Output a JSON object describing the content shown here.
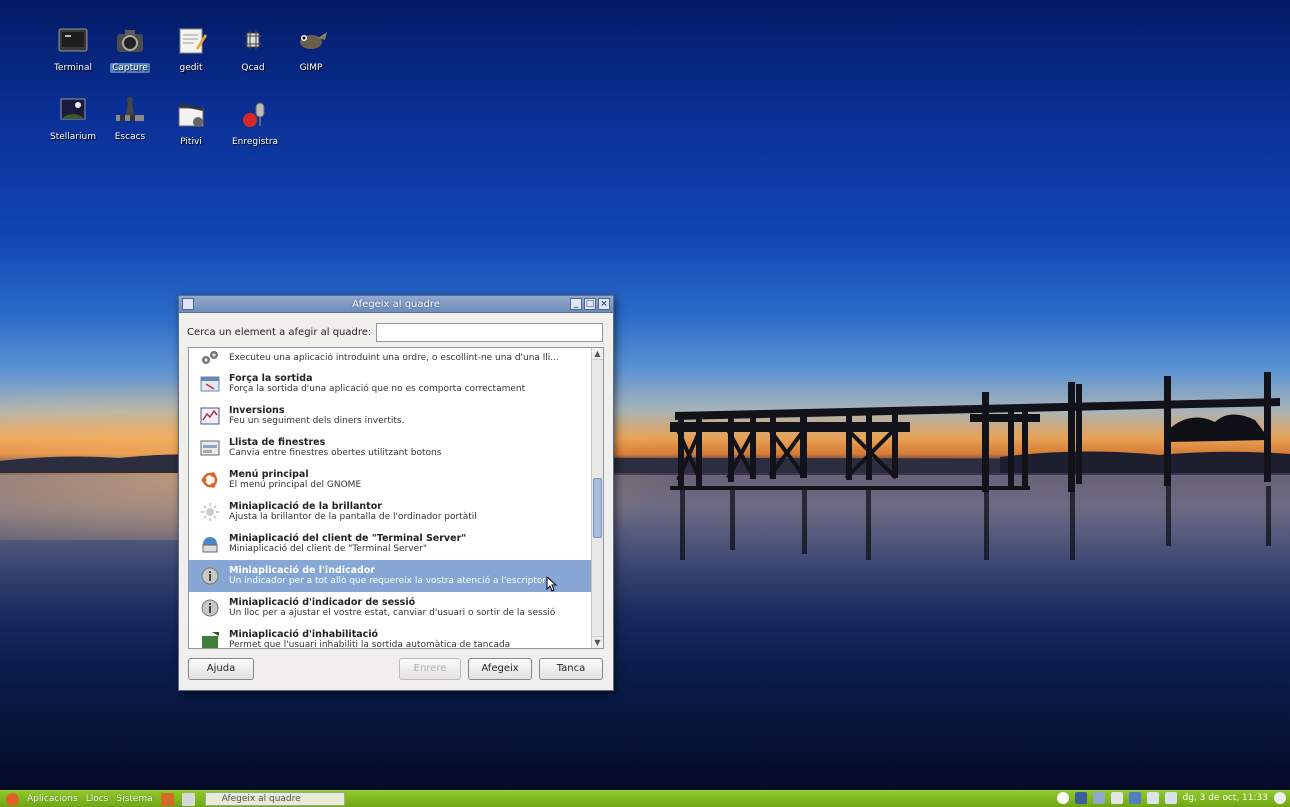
{
  "desktop": {
    "icons": [
      {
        "label": "Terminal",
        "icon": "terminal-icon"
      },
      {
        "label": "Capture",
        "icon": "camera-icon"
      },
      {
        "label": "gedit",
        "icon": "text-editor-icon"
      },
      {
        "label": "Qcad",
        "icon": "cad-icon"
      },
      {
        "label": "GIMP",
        "icon": "gimp-icon"
      },
      {
        "label": "Stellarium",
        "icon": "stellarium-icon"
      },
      {
        "label": "Escacs",
        "icon": "chess-icon"
      },
      {
        "label": "Pitivi",
        "icon": "video-editor-icon"
      },
      {
        "label": "Enregistra",
        "icon": "microphone-icon"
      }
    ]
  },
  "dialog": {
    "title": "Afegeix al quadre",
    "search_label": "Cerca un element a afegir al quadre:",
    "search_value": "",
    "items": [
      {
        "title": "",
        "desc": "Executeu una aplicació introduint una ordre, o escollint-ne una d'una lli...",
        "icon": "run-command-icon"
      },
      {
        "title": "Força la sortida",
        "desc": "Força la sortida d'una aplicació que no es comporta correctament",
        "icon": "force-quit-icon"
      },
      {
        "title": "Inversions",
        "desc": "Feu un seguiment dels diners invertits.",
        "icon": "investments-icon"
      },
      {
        "title": "Llista de finestres",
        "desc": "Canvia entre finestres obertes utilitzant botons",
        "icon": "window-list-icon"
      },
      {
        "title": "Menú principal",
        "desc": "El menú principal del GNOME",
        "icon": "ubuntu-logo-icon"
      },
      {
        "title": "Miniaplicació de la brillantor",
        "desc": "Ajusta la brillantor de la pantalla de l'ordinador portàtil",
        "icon": "brightness-icon"
      },
      {
        "title": "Miniaplicació del client de \"Terminal Server\"",
        "desc": "Miniaplicació del client de \"Terminal Server\"",
        "icon": "terminal-server-icon"
      },
      {
        "title": "Miniaplicació de l'indicador",
        "desc": "Un indicador per a tot allò que requereix la vostra atenció a l'escriptori",
        "icon": "indicator-icon"
      },
      {
        "title": "Miniaplicació d'indicador de sessió",
        "desc": "Un lloc per a ajustar el vostre estat, canviar d'usuari o sortir de la sessió",
        "icon": "session-indicator-icon"
      },
      {
        "title": "Miniaplicació d'inhabilitació",
        "desc": "Permet que l'usuari inhabiliti la sortida automàtica de tancada",
        "icon": "inhibit-icon"
      }
    ],
    "selected_index": 7,
    "buttons": {
      "help": "Ajuda",
      "back": "Enrere",
      "add": "Afegeix",
      "close": "Tanca"
    }
  },
  "panel": {
    "menus": [
      "Aplicacions",
      "Llocs",
      "Sistema"
    ],
    "task": "Afegeix al quadre",
    "clock": "dg, 3 de oct, 11:33"
  },
  "colors": {
    "panel": "#7cb51c",
    "selection": "#86a6d4",
    "titlebar": "#7f99c5"
  }
}
